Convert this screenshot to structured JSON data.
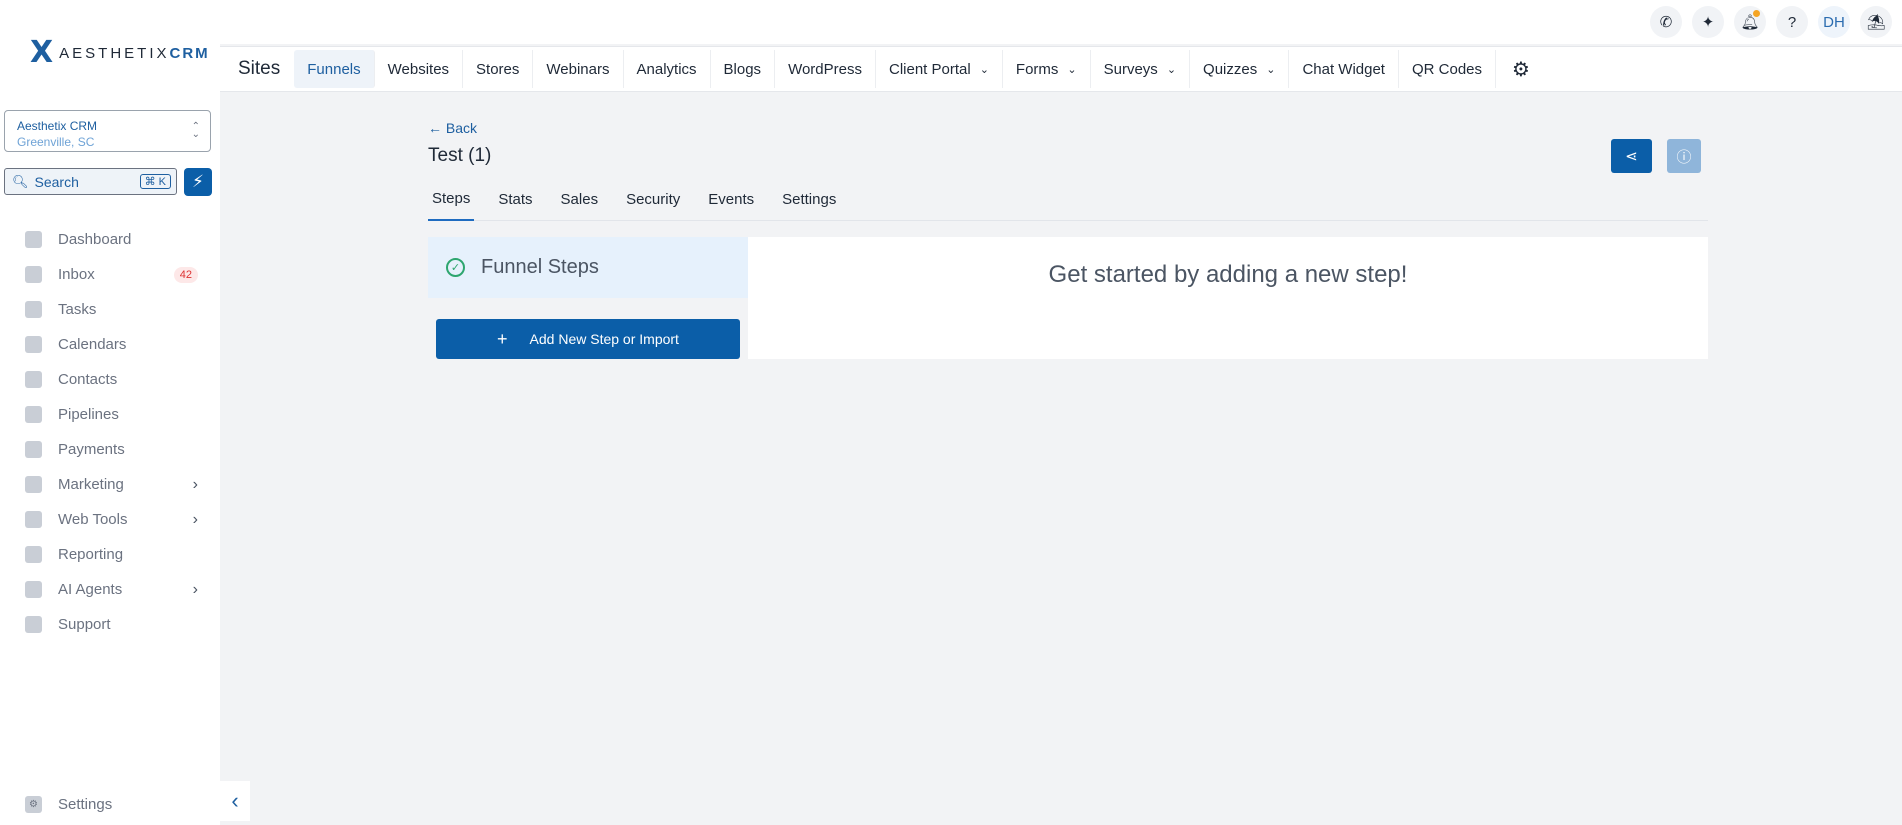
{
  "brand": {
    "logo_mark": "X",
    "name_light": "AESTHETIX",
    "name_bold": "CRM"
  },
  "location": {
    "name": "Aesthetix CRM",
    "city": "Greenville, SC"
  },
  "search": {
    "label": "Search",
    "shortcut": "⌘ K"
  },
  "topbar": {
    "avatar_initials": "DH",
    "help": "?"
  },
  "sidebar": {
    "items": [
      {
        "label": "Dashboard",
        "icon": "dashboard-icon"
      },
      {
        "label": "Inbox",
        "icon": "inbox-icon",
        "badge": "42"
      },
      {
        "label": "Tasks",
        "icon": "tasks-icon"
      },
      {
        "label": "Calendars",
        "icon": "calendar-icon"
      },
      {
        "label": "Contacts",
        "icon": "contacts-icon"
      },
      {
        "label": "Pipelines",
        "icon": "pipelines-icon"
      },
      {
        "label": "Payments",
        "icon": "payments-icon"
      },
      {
        "label": "Marketing",
        "icon": "marketing-icon",
        "has_children": true
      },
      {
        "label": "Web Tools",
        "icon": "web-tools-icon",
        "has_children": true
      },
      {
        "label": "Reporting",
        "icon": "reporting-icon"
      },
      {
        "label": "AI Agents",
        "icon": "ai-agents-icon",
        "has_children": true
      },
      {
        "label": "Support",
        "icon": "support-icon"
      }
    ],
    "settings_label": "Settings"
  },
  "sites_nav": {
    "title": "Sites",
    "tabs": [
      {
        "label": "Funnels",
        "active": true
      },
      {
        "label": "Websites"
      },
      {
        "label": "Stores"
      },
      {
        "label": "Webinars"
      },
      {
        "label": "Analytics"
      },
      {
        "label": "Blogs"
      },
      {
        "label": "WordPress"
      },
      {
        "label": "Client Portal",
        "dropdown": true
      },
      {
        "label": "Forms",
        "dropdown": true
      },
      {
        "label": "Surveys",
        "dropdown": true
      },
      {
        "label": "Quizzes",
        "dropdown": true
      },
      {
        "label": "Chat Widget"
      },
      {
        "label": "QR Codes"
      }
    ]
  },
  "funnel": {
    "back_label": "Back",
    "title": "Test (1)",
    "tabs": [
      {
        "label": "Steps",
        "active": true
      },
      {
        "label": "Stats"
      },
      {
        "label": "Sales"
      },
      {
        "label": "Security"
      },
      {
        "label": "Events"
      },
      {
        "label": "Settings"
      }
    ],
    "steps_title": "Funnel Steps",
    "add_step_label": "Add New Step or Import",
    "empty_message": "Get started by adding a new step!"
  },
  "colors": {
    "primary": "#0b5ea8",
    "accent_text": "#1e5fa0",
    "badge_red": "#d33",
    "success": "#2ea66f"
  }
}
